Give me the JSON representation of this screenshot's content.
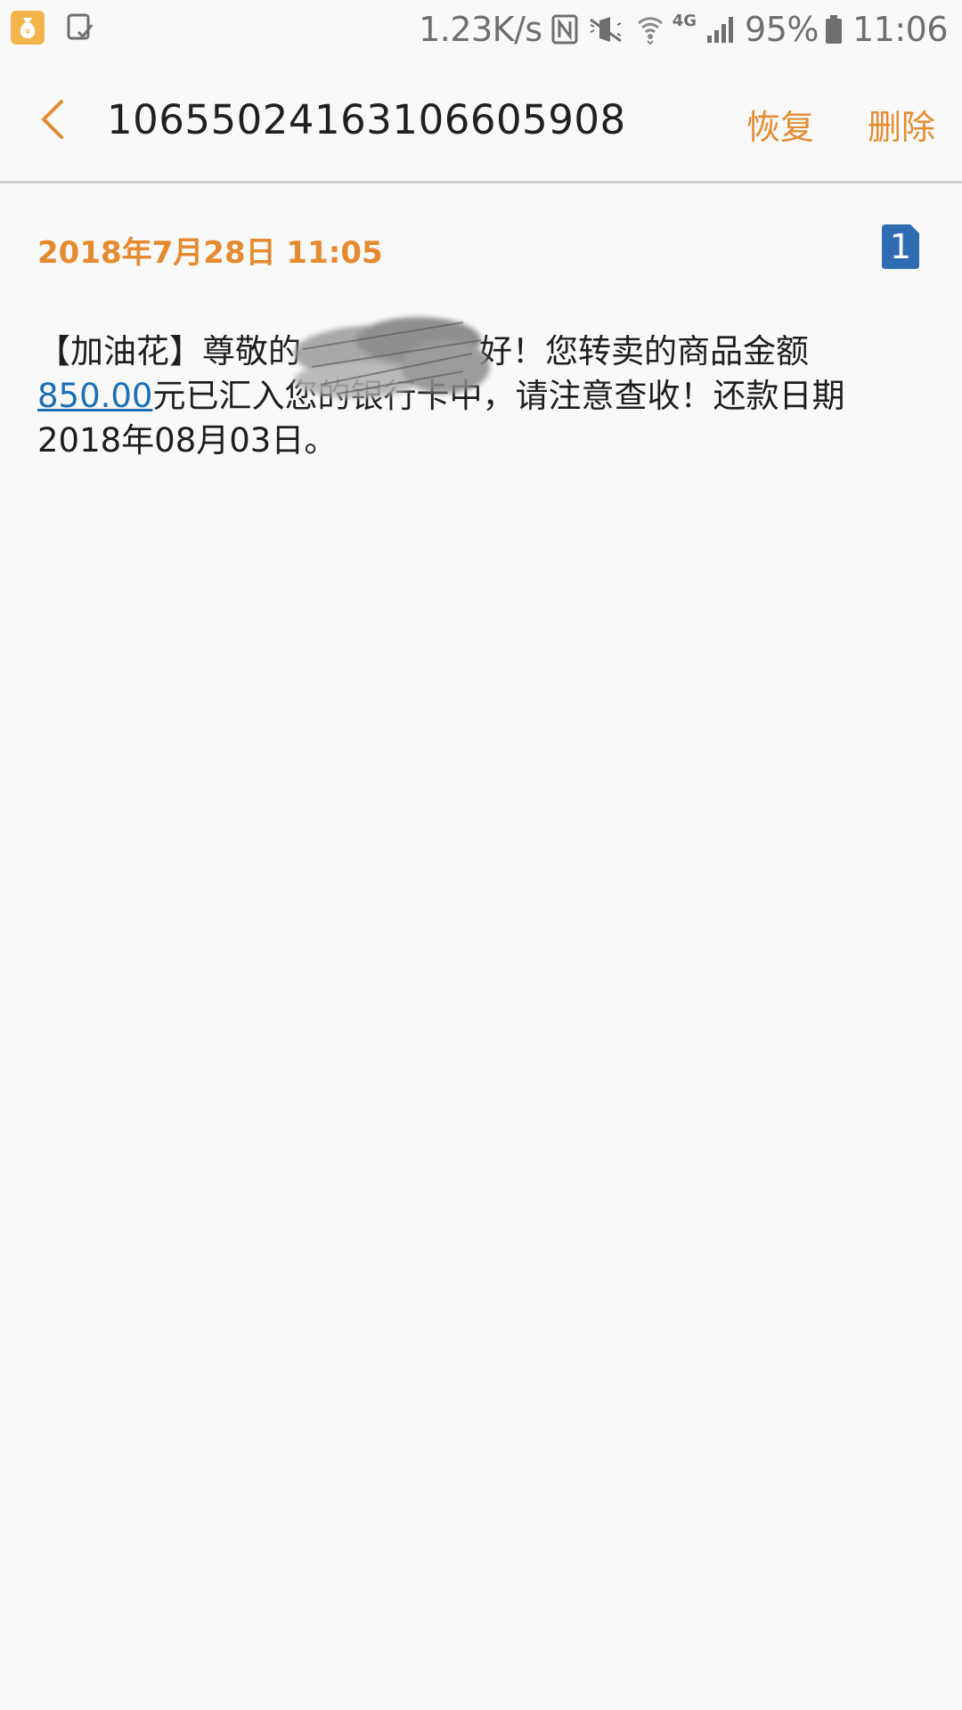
{
  "status_bar": {
    "net_speed": "1.23K/s",
    "network_type": "4G",
    "battery": "95%",
    "time": "11:06",
    "icons": [
      "money-bag-app-icon",
      "screenshot-icon",
      "nfc-icon",
      "mute-icon",
      "wifi-icon",
      "signal-icon",
      "battery-icon"
    ]
  },
  "header": {
    "title": "10655024163106605908",
    "restore_label": "恢复",
    "delete_label": "删除",
    "accent_color": "#e58a2f"
  },
  "message": {
    "date": "2018年7月28日  11:05",
    "sim_number": "1",
    "body_prefix": "【加油花】尊敬的",
    "body_redacted_tail": "好！您转卖的商品金额",
    "amount": "850.00",
    "body_suffix": "元已汇入您的银行卡中，请注意查收！还款日期2018年08月03日。",
    "link_color": "#1a6fb5"
  }
}
